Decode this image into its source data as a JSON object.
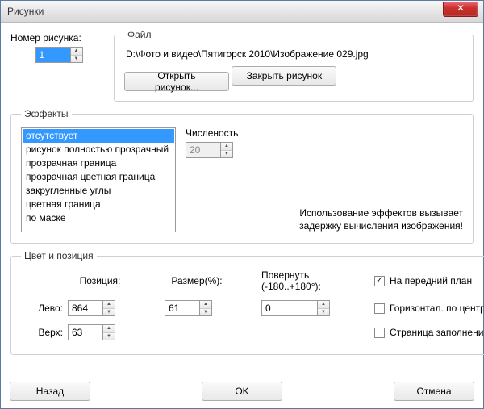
{
  "window": {
    "title": "Рисунки"
  },
  "image_number": {
    "label": "Номер рисунка:",
    "value": "1"
  },
  "file": {
    "legend": "Файл",
    "path": "D:\\Фото и видео\\Пятигорск 2010\\Изображение 029.jpg",
    "open_button": "Открыть рисунок...",
    "close_button": "Закрыть рисунок"
  },
  "effects": {
    "legend": "Эффекты",
    "items": [
      "отсутствует",
      "рисунок полностью прозрачный",
      "прозрачная граница",
      "прозрачная цветная граница",
      "закругленные углы",
      "цветная граница",
      "по маске"
    ],
    "numerosity_label": "Численость",
    "numerosity_value": "20",
    "warning1": "Использование эффектов вызывает",
    "warning2": "задержку вычисления изображения!"
  },
  "position": {
    "legend": "Цвет и позиция",
    "pos_header": "Позиция:",
    "size_header": "Размер(%):",
    "rotate_header1": "Повернуть",
    "rotate_header2": "(-180..+180°):",
    "left_label": "Лево:",
    "left_value": "864",
    "top_label": "Верх:",
    "top_value": "63",
    "size_value": "61",
    "rotate_value": "0",
    "chk_front": "На передний план",
    "chk_hcenter": "Горизонтал. по центру",
    "chk_fill": "Страница заполнения",
    "chk_front_checked": "✓"
  },
  "buttons": {
    "back": "Назад",
    "ok": "OK",
    "cancel": "Отмена"
  }
}
